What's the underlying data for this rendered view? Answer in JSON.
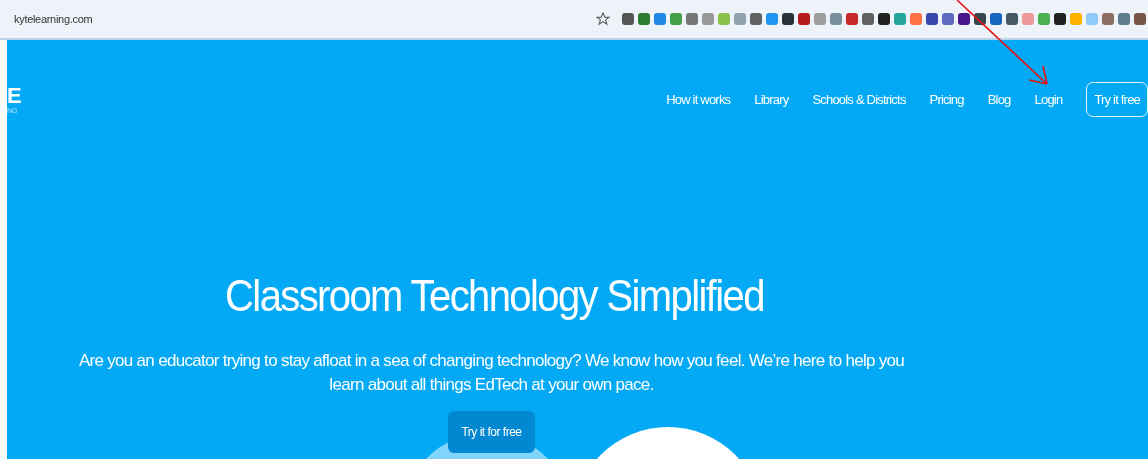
{
  "browser": {
    "url": "kytelearning.com"
  },
  "logo": {
    "letter": "E",
    "sub": "NG"
  },
  "nav": {
    "links": [
      {
        "label": "How it works"
      },
      {
        "label": "Library"
      },
      {
        "label": "Schools & Districts"
      },
      {
        "label": "Pricing"
      },
      {
        "label": "Blog"
      },
      {
        "label": "Login"
      }
    ],
    "cta": "Try it free"
  },
  "hero": {
    "title": "Classroom Technology Simplified",
    "text": "Are you an educator trying to stay afloat in a sea of changing technology? We know how you feel. We’re here to help you learn about all things EdTech at your own pace.",
    "button": "Try it for free"
  }
}
